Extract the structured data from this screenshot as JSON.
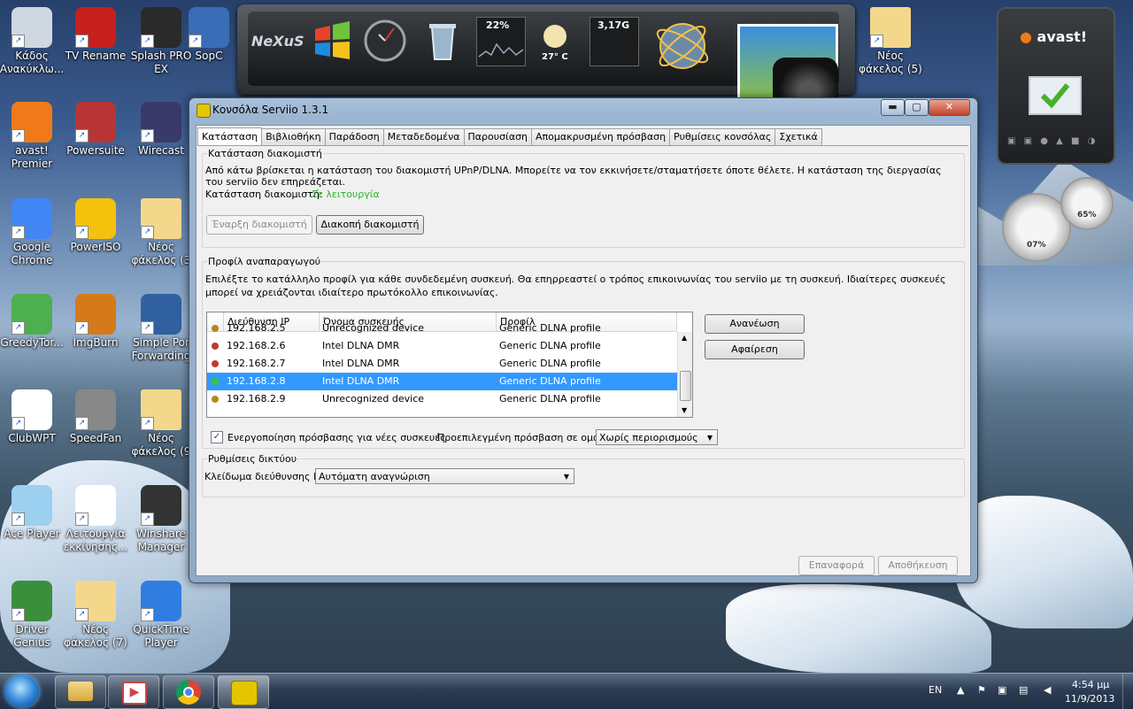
{
  "desktop": {
    "icons": [
      {
        "label": "Κάδος Ανακύκλω...",
        "icon": "recycle-bin-icon"
      },
      {
        "label": "TV Rename",
        "icon": "tv-icon"
      },
      {
        "label": "Splash PRO EX",
        "icon": "clapperboard-icon"
      },
      {
        "label": "SopC",
        "icon": "sopcast-icon"
      },
      {
        "label": "avast! Premier",
        "icon": "avast-icon"
      },
      {
        "label": "Powersuite",
        "icon": "powersuite-icon"
      },
      {
        "label": "Wirecast",
        "icon": "wirecast-icon"
      },
      {
        "label": "Google Chrome",
        "icon": "chrome-icon"
      },
      {
        "label": "PowerISO",
        "icon": "poweriso-icon"
      },
      {
        "label": "Νέος φάκελος (3",
        "icon": "folder-icon"
      },
      {
        "label": "GreedyTor...",
        "icon": "greedytorrent-icon"
      },
      {
        "label": "ImgBurn",
        "icon": "imgburn-icon"
      },
      {
        "label": "Simple Por Forwarding",
        "icon": "simple-port-forwarding-icon"
      },
      {
        "label": "ClubWPT",
        "icon": "cards-icon"
      },
      {
        "label": "SpeedFan",
        "icon": "speedfan-icon"
      },
      {
        "label": "Νέος φάκελος (9",
        "icon": "folder-icon"
      },
      {
        "label": "Ace Player",
        "icon": "ace-player-icon"
      },
      {
        "label": "Λειτουργία εκκίνησης...",
        "icon": "startup-icon"
      },
      {
        "label": "Winshare Manager",
        "icon": "winshare-icon"
      },
      {
        "label": "Driver Genius",
        "icon": "driver-genius-icon"
      },
      {
        "label": "Νέος φάκελος (7)",
        "icon": "folder-icon"
      },
      {
        "label": "QuickTime Player",
        "icon": "quicktime-icon"
      },
      {
        "label": "Νέος φάκελος (5)",
        "icon": "folder-icon"
      }
    ]
  },
  "gadgets": {
    "cpu_percent": "22%",
    "weather_temp": "27° C",
    "disk_label": "3,17G",
    "nexus_label": "NeXuS",
    "avast_label": "avast!",
    "meter_left": "07%",
    "meter_right": "65%"
  },
  "window": {
    "title": "Κονσόλα Serviio 1.3.1",
    "min": "▬",
    "max": "▢",
    "close": "✕",
    "tabs": [
      "Κατάσταση",
      "Βιβλιοθήκη",
      "Παράδοση",
      "Μεταδεδομένα",
      "Παρουσίαση",
      "Απομακρυσμένη πρόσβαση",
      "Ρυθμίσεις κονσόλας",
      "Σχετικά"
    ],
    "server_status": {
      "group_label": "Κατάσταση διακομιστή",
      "description": "Από κάτω βρίσκεται η κατάσταση του διακομιστή UPnP/DLNA. Μπορείτε να τον εκκινήσετε/σταματήσετε όποτε θέλετε. Η κατάσταση της διεργασίας του serviio δεν επηρεάζεται.",
      "status_label": "Κατάσταση διακομιστή:",
      "status_value": "Σε λειτουργία",
      "status_color": "#2bb52b",
      "start_button": "Έναρξη διακομιστή",
      "stop_button": "Διακοπή διακομιστή"
    },
    "renderer_profile": {
      "group_label": "Προφίλ αναπαραγωγού",
      "description": "Επιλέξτε το κατάλληλο προφίλ για κάθε συνδεδεμένη συσκευή. Θα επηρρεαστεί ο τρόπος επικοινωνίας του serviio με τη συσκευή. Ιδιαίτερες συσκευές μπορεί να χρειάζονται ιδιαίτερο πρωτόκολλο επικοινωνίας.",
      "columns": [
        "Διεύθυνση IP",
        "Όνομα συσκευής",
        "Προφίλ"
      ],
      "rows": [
        {
          "ip": "192.168.2.5",
          "name": "Unrecognized device",
          "profile": "Generic DLNA profile",
          "dot": "#b8861b"
        },
        {
          "ip": "192.168.2.6",
          "name": "Intel DLNA DMR",
          "profile": "Generic DLNA profile",
          "dot": "#c0392b"
        },
        {
          "ip": "192.168.2.7",
          "name": "Intel DLNA DMR",
          "profile": "Generic DLNA profile",
          "dot": "#c0392b"
        },
        {
          "ip": "192.168.2.8",
          "name": "Intel DLNA DMR",
          "profile": "Generic DLNA profile",
          "dot": "#3cc43c"
        },
        {
          "ip": "192.168.2.9",
          "name": "Unrecognized device",
          "profile": "Generic DLNA profile",
          "dot": "#b8861b"
        }
      ],
      "selected_row": 3,
      "refresh_button": "Ανανέωση",
      "remove_button": "Αφαίρεση",
      "enable_access_label": "Ενεργοποίηση πρόσβασης για νέες συσκευές",
      "enable_access_checked": true,
      "default_access_label": "Προεπιλεγμένη πρόσβαση σε ομάδα:",
      "default_access_value": "Χωρίς περιορισμούς"
    },
    "network": {
      "group_label": "Ρυθμίσεις δικτύου",
      "ip_lock_label": "Κλείδωμα διεύθυνσης IP:",
      "ip_lock_value": "Αυτόματη αναγνώριση"
    },
    "reset_button": "Επαναφορά",
    "save_button": "Αποθήκευση"
  },
  "taskbar": {
    "language": "EN",
    "time": "4:54 μμ",
    "date": "11/9/2013",
    "pinned": [
      "explorer-icon",
      "media-player-icon",
      "chrome-icon",
      "serviio-icon"
    ]
  }
}
